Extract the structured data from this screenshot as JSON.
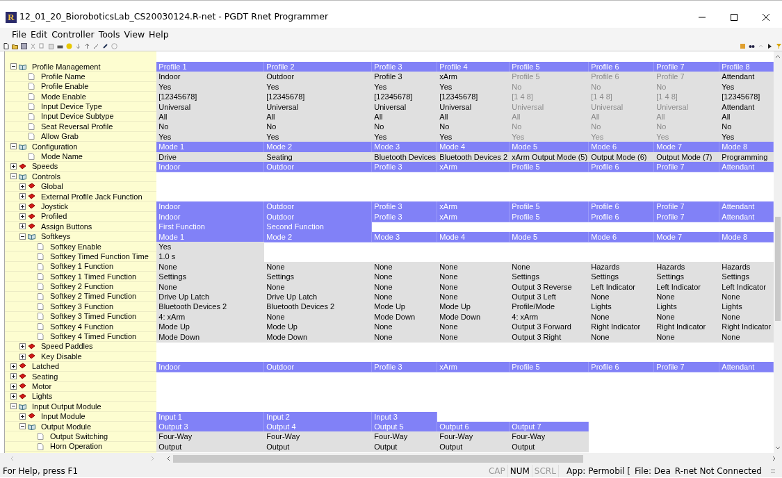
{
  "window": {
    "title": "12_01_20_BioroboticsLab_CS20030124.R-net - PGDT Rnet Programmer",
    "logo_text": "R"
  },
  "menu": [
    "File",
    "Edit",
    "Controller",
    "Tools",
    "View",
    "Help"
  ],
  "tree": [
    {
      "label": "Profile Management",
      "kind": "folder",
      "expanded": true,
      "children": [
        {
          "label": "Profile Name",
          "kind": "leaf"
        },
        {
          "label": "Profile Enable",
          "kind": "leaf"
        },
        {
          "label": "Mode Enable",
          "kind": "leaf"
        },
        {
          "label": "Input Device Type",
          "kind": "leaf"
        },
        {
          "label": "Input Device Subtype",
          "kind": "leaf"
        },
        {
          "label": "Seat Reversal Profile",
          "kind": "leaf"
        },
        {
          "label": "Allow Grab",
          "kind": "leaf"
        }
      ]
    },
    {
      "label": "Configuration",
      "kind": "folder",
      "expanded": true,
      "children": [
        {
          "label": "Mode Name",
          "kind": "leaf"
        }
      ]
    },
    {
      "label": "Speeds",
      "kind": "folder",
      "expanded": false
    },
    {
      "label": "Controls",
      "kind": "folder",
      "expanded": true,
      "children": [
        {
          "label": "Global",
          "kind": "folder",
          "expanded": false
        },
        {
          "label": "External Profile Jack Function",
          "kind": "folder",
          "expanded": false
        },
        {
          "label": "Joystick",
          "kind": "folder",
          "expanded": false
        },
        {
          "label": "Profiled",
          "kind": "folder",
          "expanded": false
        },
        {
          "label": "Assign Buttons",
          "kind": "folder",
          "expanded": false
        },
        {
          "label": "Softkeys",
          "kind": "folder",
          "expanded": true,
          "children": [
            {
              "label": "Softkey Enable",
              "kind": "leaf"
            },
            {
              "label": "Softkey Timed Function Time",
              "kind": "leaf"
            },
            {
              "label": "Softkey 1 Function",
              "kind": "leaf"
            },
            {
              "label": "Softkey 1 Timed Function",
              "kind": "leaf"
            },
            {
              "label": "Softkey 2 Function",
              "kind": "leaf"
            },
            {
              "label": "Softkey 2 Timed Function",
              "kind": "leaf"
            },
            {
              "label": "Softkey 3 Function",
              "kind": "leaf"
            },
            {
              "label": "Softkey 3 Timed Function",
              "kind": "leaf"
            },
            {
              "label": "Softkey 4 Function",
              "kind": "leaf"
            },
            {
              "label": "Softkey 4 Timed Function",
              "kind": "leaf"
            }
          ]
        },
        {
          "label": "Speed Paddles",
          "kind": "folder",
          "expanded": false
        },
        {
          "label": "Key Disable",
          "kind": "folder",
          "expanded": false
        }
      ]
    },
    {
      "label": "Latched",
      "kind": "folder",
      "expanded": false
    },
    {
      "label": "Seating",
      "kind": "folder",
      "expanded": false
    },
    {
      "label": "Motor",
      "kind": "folder",
      "expanded": false
    },
    {
      "label": "Lights",
      "kind": "folder",
      "expanded": false
    },
    {
      "label": "Input Output Module",
      "kind": "folder",
      "expanded": true,
      "children": [
        {
          "label": "Input Module",
          "kind": "folder",
          "expanded": false
        },
        {
          "label": "Output Module",
          "kind": "folder",
          "expanded": true,
          "children": [
            {
              "label": "Output Switching",
              "kind": "leaf"
            },
            {
              "label": "Horn Operation",
              "kind": "leaf"
            }
          ]
        }
      ]
    }
  ],
  "grid_rows": [
    {
      "kind": "header",
      "cells": [
        {
          "text": "Profile 1",
          "disabled": false
        },
        {
          "text": "Profile 2",
          "disabled": false
        },
        {
          "text": "Profile 3",
          "disabled": false
        },
        {
          "text": "Profile 4",
          "disabled": false
        },
        {
          "text": "Profile 5",
          "disabled": false
        },
        {
          "text": "Profile 6",
          "disabled": false
        },
        {
          "text": "Profile 7",
          "disabled": false
        },
        {
          "text": "Profile 8",
          "disabled": false
        }
      ]
    },
    {
      "kind": "value",
      "cells": [
        {
          "text": "Indoor",
          "disabled": false
        },
        {
          "text": "Outdoor",
          "disabled": false
        },
        {
          "text": "Profile 3",
          "disabled": false
        },
        {
          "text": "xArm",
          "disabled": false
        },
        {
          "text": "Profile 5",
          "disabled": true
        },
        {
          "text": "Profile 6",
          "disabled": true
        },
        {
          "text": "Profile 7",
          "disabled": true
        },
        {
          "text": "Attendant",
          "disabled": false
        }
      ]
    },
    {
      "kind": "value",
      "cells": [
        {
          "text": "Yes",
          "disabled": false
        },
        {
          "text": "Yes",
          "disabled": false
        },
        {
          "text": "Yes",
          "disabled": false
        },
        {
          "text": "Yes",
          "disabled": false
        },
        {
          "text": "No",
          "disabled": true
        },
        {
          "text": "No",
          "disabled": true
        },
        {
          "text": "No",
          "disabled": true
        },
        {
          "text": "Yes",
          "disabled": false
        }
      ]
    },
    {
      "kind": "value",
      "cells": [
        {
          "text": "[12345678]",
          "disabled": false
        },
        {
          "text": "[12345678]",
          "disabled": false
        },
        {
          "text": "[12345678]",
          "disabled": false
        },
        {
          "text": "[12345678]",
          "disabled": false
        },
        {
          "text": "[1  4   8]",
          "disabled": true
        },
        {
          "text": "[1  4   8]",
          "disabled": true
        },
        {
          "text": "[1  4   8]",
          "disabled": true
        },
        {
          "text": "[12345678]",
          "disabled": false
        }
      ]
    },
    {
      "kind": "value",
      "cells": [
        {
          "text": "Universal",
          "disabled": false
        },
        {
          "text": "Universal",
          "disabled": false
        },
        {
          "text": "Universal",
          "disabled": false
        },
        {
          "text": "Universal",
          "disabled": false
        },
        {
          "text": "Universal",
          "disabled": true
        },
        {
          "text": "Universal",
          "disabled": true
        },
        {
          "text": "Universal",
          "disabled": true
        },
        {
          "text": "Attendant",
          "disabled": false
        }
      ]
    },
    {
      "kind": "value",
      "cells": [
        {
          "text": "All",
          "disabled": false
        },
        {
          "text": "All",
          "disabled": false
        },
        {
          "text": "All",
          "disabled": false
        },
        {
          "text": "All",
          "disabled": false
        },
        {
          "text": "All",
          "disabled": true
        },
        {
          "text": "All",
          "disabled": true
        },
        {
          "text": "All",
          "disabled": true
        },
        {
          "text": "All",
          "disabled": false
        }
      ]
    },
    {
      "kind": "value",
      "cells": [
        {
          "text": "No",
          "disabled": false
        },
        {
          "text": "No",
          "disabled": false
        },
        {
          "text": "No",
          "disabled": false
        },
        {
          "text": "No",
          "disabled": false
        },
        {
          "text": "No",
          "disabled": true
        },
        {
          "text": "No",
          "disabled": true
        },
        {
          "text": "No",
          "disabled": true
        },
        {
          "text": "No",
          "disabled": false
        }
      ]
    },
    {
      "kind": "value",
      "cells": [
        {
          "text": "Yes",
          "disabled": false
        },
        {
          "text": "Yes",
          "disabled": false
        },
        {
          "text": "Yes",
          "disabled": false
        },
        {
          "text": "Yes",
          "disabled": false
        },
        {
          "text": "Yes",
          "disabled": true
        },
        {
          "text": "Yes",
          "disabled": true
        },
        {
          "text": "Yes",
          "disabled": true
        },
        {
          "text": "Yes",
          "disabled": false
        }
      ]
    },
    {
      "kind": "header",
      "cells": [
        {
          "text": "Mode 1",
          "disabled": false
        },
        {
          "text": "Mode 2",
          "disabled": false
        },
        {
          "text": "Mode 3",
          "disabled": false
        },
        {
          "text": "Mode 4",
          "disabled": false
        },
        {
          "text": "Mode 5",
          "disabled": false
        },
        {
          "text": "Mode 6",
          "disabled": false
        },
        {
          "text": "Mode 7",
          "disabled": false
        },
        {
          "text": "Mode 8",
          "disabled": false
        }
      ]
    },
    {
      "kind": "value",
      "cells": [
        {
          "text": "Drive",
          "disabled": false
        },
        {
          "text": "Seating",
          "disabled": false
        },
        {
          "text": "Bluetooth Devices",
          "disabled": false
        },
        {
          "text": "Bluetooth Devices 2",
          "disabled": false
        },
        {
          "text": "xArm Output Mode (5)",
          "disabled": false
        },
        {
          "text": "Output Mode (6)",
          "disabled": false
        },
        {
          "text": "Output Mode (7)",
          "disabled": false
        },
        {
          "text": "Programming",
          "disabled": false
        }
      ]
    },
    {
      "kind": "header",
      "cells": [
        {
          "text": "Indoor",
          "disabled": false
        },
        {
          "text": "Outdoor",
          "disabled": false
        },
        {
          "text": "Profile 3",
          "disabled": false
        },
        {
          "text": "xArm",
          "disabled": false
        },
        {
          "text": "Profile 5",
          "disabled": false
        },
        {
          "text": "Profile 6",
          "disabled": false
        },
        {
          "text": "Profile 7",
          "disabled": false
        },
        {
          "text": "Attendant",
          "disabled": false
        }
      ]
    },
    {
      "kind": "empty"
    },
    {
      "kind": "empty"
    },
    {
      "kind": "empty"
    },
    {
      "kind": "header",
      "cells": [
        {
          "text": "Indoor",
          "disabled": false
        },
        {
          "text": "Outdoor",
          "disabled": false
        },
        {
          "text": "Profile 3",
          "disabled": false
        },
        {
          "text": "xArm",
          "disabled": false
        },
        {
          "text": "Profile 5",
          "disabled": false
        },
        {
          "text": "Profile 6",
          "disabled": false
        },
        {
          "text": "Profile 7",
          "disabled": false
        },
        {
          "text": "Attendant",
          "disabled": false
        }
      ]
    },
    {
      "kind": "header",
      "cells": [
        {
          "text": "Indoor",
          "disabled": false
        },
        {
          "text": "Outdoor",
          "disabled": false
        },
        {
          "text": "Profile 3",
          "disabled": false
        },
        {
          "text": "xArm",
          "disabled": false
        },
        {
          "text": "Profile 5",
          "disabled": false
        },
        {
          "text": "Profile 6",
          "disabled": false
        },
        {
          "text": "Profile 7",
          "disabled": false
        },
        {
          "text": "Attendant",
          "disabled": false
        }
      ]
    },
    {
      "kind": "header",
      "cells": [
        {
          "text": "First Function",
          "disabled": false
        },
        {
          "text": "Second Function",
          "disabled": false
        }
      ]
    },
    {
      "kind": "header",
      "cells": [
        {
          "text": "Mode 1",
          "disabled": false
        },
        {
          "text": "Mode 2",
          "disabled": false
        },
        {
          "text": "Mode 3",
          "disabled": false
        },
        {
          "text": "Mode 4",
          "disabled": false
        },
        {
          "text": "Mode 5",
          "disabled": false
        },
        {
          "text": "Mode 6",
          "disabled": false
        },
        {
          "text": "Mode 7",
          "disabled": false
        },
        {
          "text": "Mode 8",
          "disabled": false
        }
      ]
    },
    {
      "kind": "value",
      "cells": [
        {
          "text": "Yes",
          "disabled": false
        }
      ]
    },
    {
      "kind": "value",
      "cells": [
        {
          "text": "1.0 s",
          "disabled": false
        }
      ]
    },
    {
      "kind": "value",
      "cells": [
        {
          "text": "None",
          "disabled": false
        },
        {
          "text": "None",
          "disabled": false
        },
        {
          "text": "None",
          "disabled": false
        },
        {
          "text": "None",
          "disabled": false
        },
        {
          "text": "None",
          "disabled": false
        },
        {
          "text": "Hazards",
          "disabled": false
        },
        {
          "text": "Hazards",
          "disabled": false
        },
        {
          "text": "Hazards",
          "disabled": false
        }
      ]
    },
    {
      "kind": "value",
      "cells": [
        {
          "text": "Settings",
          "disabled": false
        },
        {
          "text": "Settings",
          "disabled": false
        },
        {
          "text": "None",
          "disabled": false
        },
        {
          "text": "None",
          "disabled": false
        },
        {
          "text": "Settings",
          "disabled": false
        },
        {
          "text": "Settings",
          "disabled": false
        },
        {
          "text": "Settings",
          "disabled": false
        },
        {
          "text": "Settings",
          "disabled": false
        }
      ]
    },
    {
      "kind": "value",
      "cells": [
        {
          "text": "None",
          "disabled": false
        },
        {
          "text": "None",
          "disabled": false
        },
        {
          "text": "None",
          "disabled": false
        },
        {
          "text": "None",
          "disabled": false
        },
        {
          "text": "Output 3 Reverse",
          "disabled": false
        },
        {
          "text": "Left Indicator",
          "disabled": false
        },
        {
          "text": "Left Indicator",
          "disabled": false
        },
        {
          "text": "Left Indicator",
          "disabled": false
        }
      ]
    },
    {
      "kind": "value",
      "cells": [
        {
          "text": "Drive Up Latch",
          "disabled": false
        },
        {
          "text": "Drive Up Latch",
          "disabled": false
        },
        {
          "text": "None",
          "disabled": false
        },
        {
          "text": "None",
          "disabled": false
        },
        {
          "text": "Output 3 Left",
          "disabled": false
        },
        {
          "text": "None",
          "disabled": false
        },
        {
          "text": "None",
          "disabled": false
        },
        {
          "text": "None",
          "disabled": false
        }
      ]
    },
    {
      "kind": "value",
      "cells": [
        {
          "text": "Bluetooth Devices 2",
          "disabled": false
        },
        {
          "text": "Bluetooth Devices 2",
          "disabled": false
        },
        {
          "text": "Mode Up",
          "disabled": false
        },
        {
          "text": "Mode Up",
          "disabled": false
        },
        {
          "text": "Profile/Mode",
          "disabled": false
        },
        {
          "text": "Lights",
          "disabled": false
        },
        {
          "text": "Lights",
          "disabled": false
        },
        {
          "text": "Lights",
          "disabled": false
        }
      ]
    },
    {
      "kind": "value",
      "cells": [
        {
          "text": "4: xArm",
          "disabled": false
        },
        {
          "text": "None",
          "disabled": false
        },
        {
          "text": "Mode Down",
          "disabled": false
        },
        {
          "text": "Mode Down",
          "disabled": false
        },
        {
          "text": "4: xArm",
          "disabled": false
        },
        {
          "text": "None",
          "disabled": false
        },
        {
          "text": "None",
          "disabled": false
        },
        {
          "text": "None",
          "disabled": false
        }
      ]
    },
    {
      "kind": "value",
      "cells": [
        {
          "text": "Mode Up",
          "disabled": false
        },
        {
          "text": "Mode Up",
          "disabled": false
        },
        {
          "text": "None",
          "disabled": false
        },
        {
          "text": "None",
          "disabled": false
        },
        {
          "text": "Output 3 Forward",
          "disabled": false
        },
        {
          "text": "Right Indicator",
          "disabled": false
        },
        {
          "text": "Right Indicator",
          "disabled": false
        },
        {
          "text": "Right Indicator",
          "disabled": false
        }
      ]
    },
    {
      "kind": "value",
      "cells": [
        {
          "text": "Mode Down",
          "disabled": false
        },
        {
          "text": "Mode Down",
          "disabled": false
        },
        {
          "text": "None",
          "disabled": false
        },
        {
          "text": "None",
          "disabled": false
        },
        {
          "text": "Output 3 Right",
          "disabled": false
        },
        {
          "text": "None",
          "disabled": false
        },
        {
          "text": "None",
          "disabled": false
        },
        {
          "text": "None",
          "disabled": false
        }
      ]
    },
    {
      "kind": "empty"
    },
    {
      "kind": "empty"
    },
    {
      "kind": "header",
      "cells": [
        {
          "text": "Indoor",
          "disabled": false
        },
        {
          "text": "Outdoor",
          "disabled": false
        },
        {
          "text": "Profile 3",
          "disabled": false
        },
        {
          "text": "xArm",
          "disabled": false
        },
        {
          "text": "Profile 5",
          "disabled": false
        },
        {
          "text": "Profile 6",
          "disabled": false
        },
        {
          "text": "Profile 7",
          "disabled": false
        },
        {
          "text": "Attendant",
          "disabled": false
        }
      ]
    },
    {
      "kind": "empty"
    },
    {
      "kind": "empty"
    },
    {
      "kind": "empty"
    },
    {
      "kind": "empty"
    },
    {
      "kind": "header",
      "cells": [
        {
          "text": "Input 1",
          "disabled": false
        },
        {
          "text": "Input 2",
          "disabled": false
        },
        {
          "text": "Input 3",
          "disabled": false
        }
      ]
    },
    {
      "kind": "header",
      "cells": [
        {
          "text": "Output 3",
          "disabled": false
        },
        {
          "text": "Output 4",
          "disabled": false
        },
        {
          "text": "Output 5",
          "disabled": false
        },
        {
          "text": "Output 6",
          "disabled": false
        },
        {
          "text": "Output 7",
          "disabled": false
        }
      ]
    },
    {
      "kind": "value",
      "cells": [
        {
          "text": "Four-Way",
          "disabled": false
        },
        {
          "text": "Four-Way",
          "disabled": false
        },
        {
          "text": "Four-Way",
          "disabled": false
        },
        {
          "text": "Four-Way",
          "disabled": false
        },
        {
          "text": "Four-Way",
          "disabled": false
        }
      ]
    },
    {
      "kind": "value",
      "cells": [
        {
          "text": "Output",
          "disabled": false
        },
        {
          "text": "Output",
          "disabled": false
        },
        {
          "text": "Output",
          "disabled": false
        },
        {
          "text": "Output",
          "disabled": false
        },
        {
          "text": "Output",
          "disabled": false
        }
      ]
    }
  ],
  "status_bar": {
    "help": "For Help, press F1",
    "indicators": [
      {
        "label": "CAP",
        "on": false
      },
      {
        "label": "NUM",
        "on": true
      },
      {
        "label": "SCRL",
        "on": false
      }
    ],
    "panes": [
      "App: Permobil [",
      "File: Dea",
      "R-net Not Connected"
    ]
  }
}
